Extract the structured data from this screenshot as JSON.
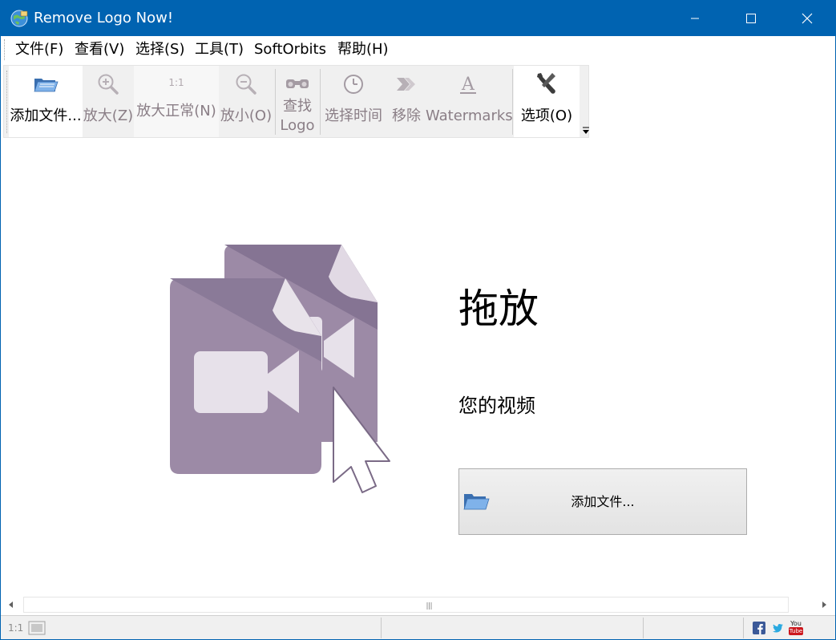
{
  "window": {
    "title": "Remove Logo Now!"
  },
  "menu": [
    {
      "label": "文件(F)",
      "name": "menu-file"
    },
    {
      "label": "查看(V)",
      "name": "menu-view"
    },
    {
      "label": "选择(S)",
      "name": "menu-select"
    },
    {
      "label": "工具(T)",
      "name": "menu-tools"
    },
    {
      "label": "SoftOrbits",
      "name": "menu-softorbits"
    },
    {
      "label": "帮助(H)",
      "name": "menu-help"
    }
  ],
  "toolbar": {
    "add_file": {
      "label": "添加文件...",
      "icon": "folder-open-icon",
      "enabled": true
    },
    "zoom_in": {
      "label": "放大(Z)",
      "icon": "zoom-in-icon",
      "enabled": false
    },
    "zoom_normal": {
      "label": "放大正常(N)",
      "icon": "one-to-one-icon",
      "icon_text": "1:1",
      "enabled": false
    },
    "zoom_out": {
      "label": "放小(O)",
      "icon": "zoom-out-icon",
      "enabled": false
    },
    "find_logo": {
      "label_line1": "查找",
      "label_line2": "Logo",
      "icon": "binoculars-icon",
      "enabled": false
    },
    "select_time": {
      "label": "选择时间",
      "icon": "clock-icon",
      "enabled": false
    },
    "remove": {
      "label": "移除",
      "icon": "chevron-forward-icon",
      "enabled": false
    },
    "watermarks": {
      "label": "Watermarks",
      "icon": "text-a-icon",
      "enabled": false
    },
    "options": {
      "label": "选项(O)",
      "icon": "wrench-icon",
      "enabled": true
    }
  },
  "drop_zone": {
    "title": "拖放",
    "subtitle": "您的视频",
    "add_button_label": "添加文件..."
  },
  "statusbar": {
    "zoom_label": "1:1",
    "youtube_text_top": "You",
    "youtube_text_bottom": "Tube"
  },
  "colors": {
    "titlebar": "#0063b1",
    "illustration_purple": "#9c8aa6",
    "illustration_dark": "#857493",
    "illustration_light": "#e7e1ea",
    "disabled_text": "#8a7e86"
  }
}
